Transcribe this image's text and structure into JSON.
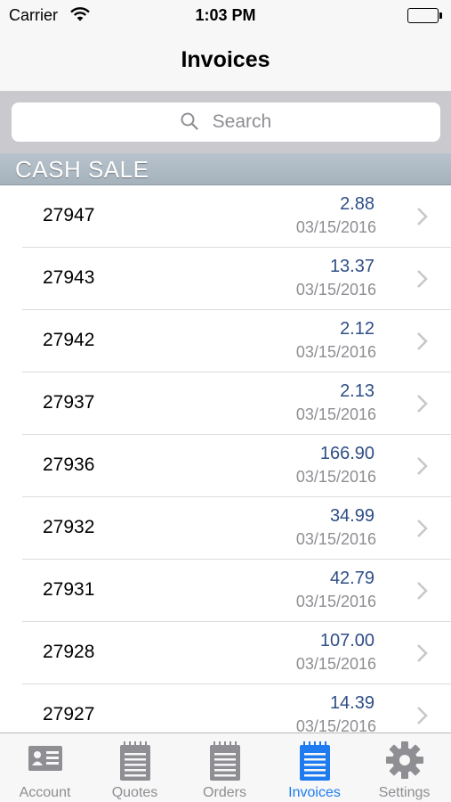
{
  "status_bar": {
    "carrier": "Carrier",
    "time": "1:03 PM"
  },
  "nav": {
    "title": "Invoices"
  },
  "search": {
    "placeholder": "Search"
  },
  "section": {
    "title": "CASH SALE"
  },
  "invoices": [
    {
      "number": "27947",
      "amount": "2.88",
      "date": "03/15/2016"
    },
    {
      "number": "27943",
      "amount": "13.37",
      "date": "03/15/2016"
    },
    {
      "number": "27942",
      "amount": "2.12",
      "date": "03/15/2016"
    },
    {
      "number": "27937",
      "amount": "2.13",
      "date": "03/15/2016"
    },
    {
      "number": "27936",
      "amount": "166.90",
      "date": "03/15/2016"
    },
    {
      "number": "27932",
      "amount": "34.99",
      "date": "03/15/2016"
    },
    {
      "number": "27931",
      "amount": "42.79",
      "date": "03/15/2016"
    },
    {
      "number": "27928",
      "amount": "107.00",
      "date": "03/15/2016"
    },
    {
      "number": "27927",
      "amount": "14.39",
      "date": "03/15/2016"
    }
  ],
  "tabs": [
    {
      "label": "Account",
      "icon": "account-card-icon",
      "active": false
    },
    {
      "label": "Quotes",
      "icon": "notepad-icon",
      "active": false
    },
    {
      "label": "Orders",
      "icon": "notepad-icon",
      "active": false
    },
    {
      "label": "Invoices",
      "icon": "notepad-icon",
      "active": true
    },
    {
      "label": "Settings",
      "icon": "gear-icon",
      "active": false
    }
  ],
  "colors": {
    "accent": "#1e7cf0",
    "amount_text": "#2f4e86",
    "section_header": "#a5b2bc",
    "inactive_icon": "#8e8e93"
  }
}
